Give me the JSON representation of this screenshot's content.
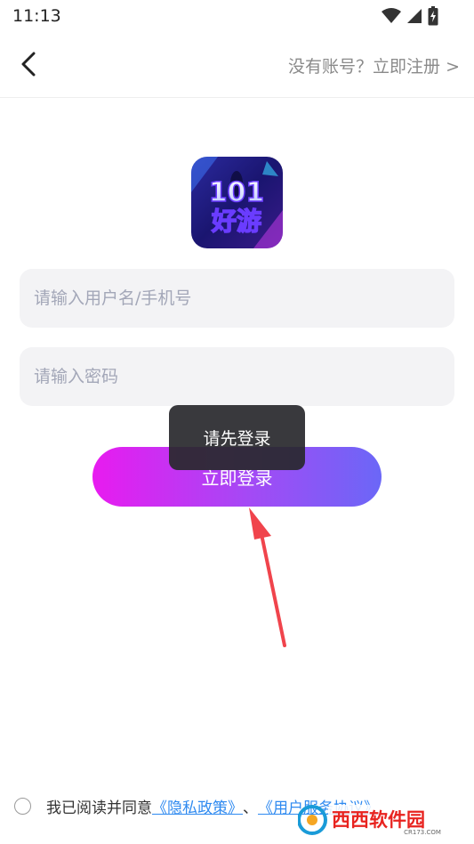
{
  "status_bar": {
    "time": "11:13"
  },
  "nav": {
    "register_prompt": "没有账号？立即注册 >"
  },
  "logo": {
    "line1": "101",
    "line2": "好游"
  },
  "form": {
    "username_placeholder": "请输入用户名/手机号",
    "password_placeholder": "请输入密码",
    "login_label": "立即登录"
  },
  "toast": {
    "message": "请先登录"
  },
  "agreement": {
    "prefix": "我已阅读并同意",
    "privacy_link": "《隐私政策》",
    "separator": "、",
    "terms_link": "《用户服务协议》"
  },
  "watermark": {
    "brand": "西西软件园",
    "domain": "CR173.COM"
  },
  "colors": {
    "accent_start": "#e81bf0",
    "accent_end": "#6b67f7",
    "link": "#2f8af0",
    "arrow": "#f0444c"
  }
}
